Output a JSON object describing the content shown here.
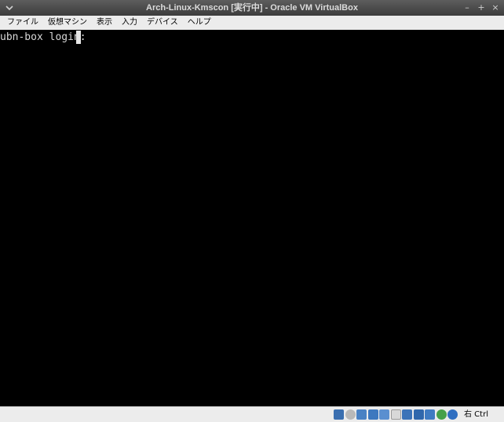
{
  "window": {
    "title": "Arch-Linux-Kmscon [実行中] - Oracle VM VirtualBox",
    "menu_icon": "chevron-down-icon",
    "minimize_glyph": "–",
    "maximize_glyph": "+",
    "close_glyph": "×"
  },
  "menubar": {
    "items": [
      "ファイル",
      "仮想マシン",
      "表示",
      "入力",
      "デバイス",
      "ヘルプ"
    ]
  },
  "console": {
    "prompt": "ubn-box login: "
  },
  "statusbar": {
    "icons": [
      {
        "name": "hard-disk-icon",
        "color": "#3a6fb0"
      },
      {
        "name": "optical-drive-icon",
        "color": "#b9b9b9"
      },
      {
        "name": "audio-icon",
        "color": "#4a82c4"
      },
      {
        "name": "network-icon",
        "color": "#3d78bf"
      },
      {
        "name": "usb-icon",
        "color": "#5a8fd0"
      },
      {
        "name": "shared-folders-icon",
        "color": "#d8d8d8"
      },
      {
        "name": "display-icon",
        "color": "#3b73b8"
      },
      {
        "name": "video-capture-icon",
        "color": "#2f67ac"
      },
      {
        "name": "virtualization-icon",
        "color": "#3f7bc2"
      },
      {
        "name": "guest-additions-icon",
        "color": "#45a04a"
      },
      {
        "name": "mouse-integration-icon",
        "color": "#2f6fc1"
      }
    ],
    "host_key": "右 Ctrl"
  }
}
